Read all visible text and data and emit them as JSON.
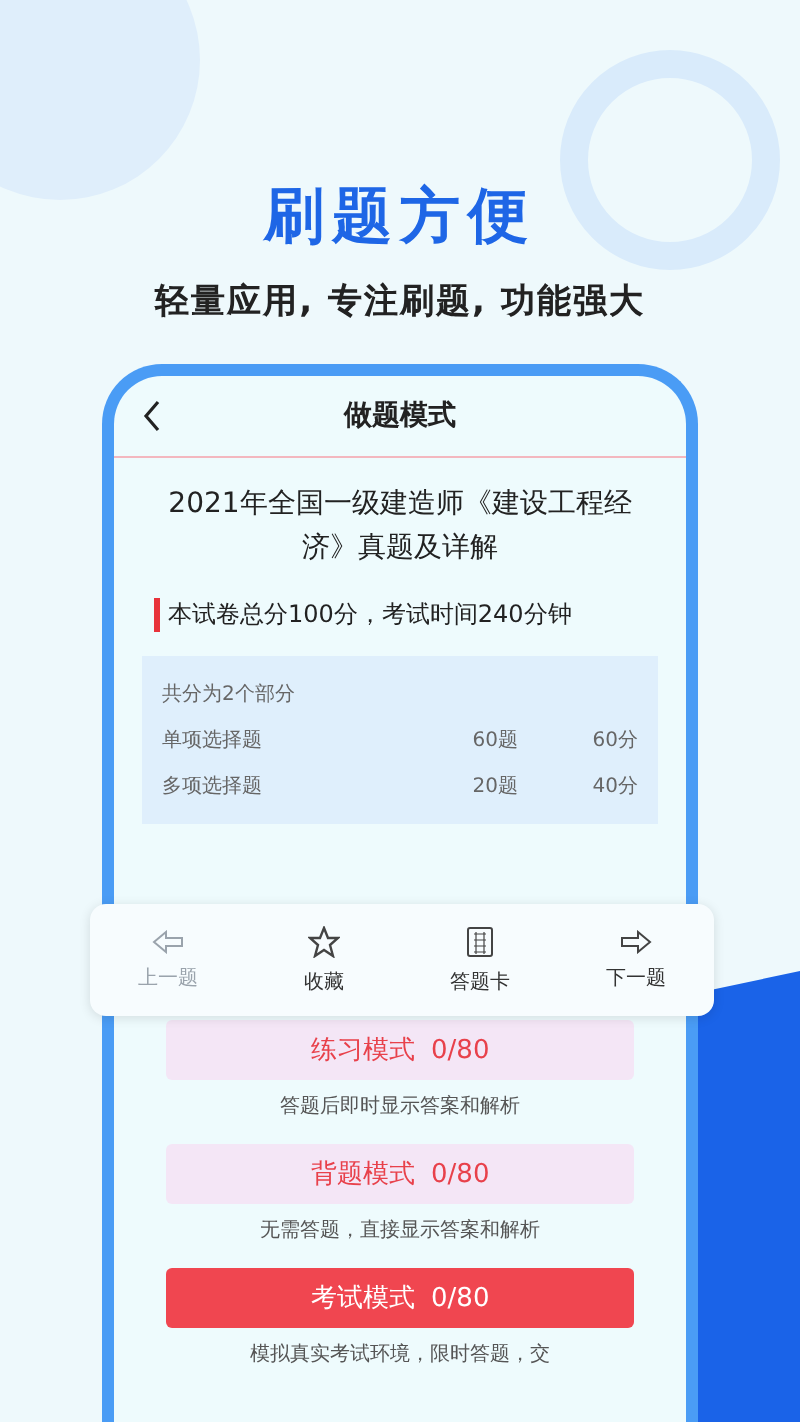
{
  "headline": "刷题方便",
  "tagline": "轻量应用, 专注刷题, 功能强大",
  "screen": {
    "title": "做题模式",
    "paper_title": "2021年全国一级建造师《建设工程经济》真题及详解",
    "paper_info": "本试卷总分100分，考试时间240分钟",
    "summary": {
      "heading": "共分为2个部分",
      "rows": [
        {
          "name": "单项选择题",
          "count": "60题",
          "score": "60分"
        },
        {
          "name": "多项选择题",
          "count": "20题",
          "score": "40分"
        }
      ]
    },
    "toolbar": [
      {
        "kind": "prev",
        "label": "上一题",
        "disabled": true
      },
      {
        "kind": "star",
        "label": "收藏",
        "disabled": false
      },
      {
        "kind": "card",
        "label": "答题卡",
        "disabled": false
      },
      {
        "kind": "next",
        "label": "下一题",
        "disabled": false
      }
    ],
    "modes": [
      {
        "label": "练习模式",
        "progress": "0/80",
        "primary": false,
        "description": "答题后即时显示答案和解析"
      },
      {
        "label": "背题模式",
        "progress": "0/80",
        "primary": false,
        "description": "无需答题，直接显示答案和解析"
      },
      {
        "label": "考试模式",
        "progress": "0/80",
        "primary": true,
        "description": "模拟真实考试环境，限时答题，交"
      }
    ]
  }
}
